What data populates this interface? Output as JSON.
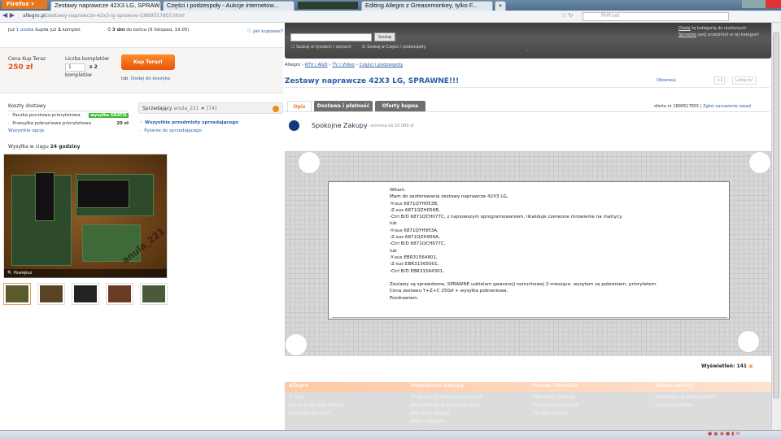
{
  "browser": {
    "menu_label": "Firefox",
    "tabs": [
      {
        "label": "Zestawy naprawcze 42X3 LG, SPRAW...",
        "active": true
      },
      {
        "label": "Części i podzespoły - Aukcje internetow...",
        "active": false
      },
      {
        "label": "Editing Allegro z Greasemonkey, tylko F...",
        "active": false
      }
    ],
    "new_tab": "+",
    "url_domain": "allegro.pl",
    "url_path": "/zestawy-naprawcze-42x3-lg-sprawne-i1899517855.html",
    "search_engine_placeholder": "PHP.net"
  },
  "top_info": {
    "bought_prefix": "Już",
    "bought_count": "1 osoba",
    "bought_suffix": "kupiła już",
    "bought_qty": "1",
    "bought_unit": "komplet",
    "days_left": "3 dni",
    "ends_text": "do końca (9 listopad, 19:05)",
    "how_to_buy": "Jak kupować?"
  },
  "purchase": {
    "price_label": "Cena Kup Teraz",
    "price": "250 zł",
    "qty_label": "Liczba kompletów",
    "qty_value": "1",
    "qty_of": "z 2",
    "qty_unit": "kompletów",
    "buy_button": "Kup Teraz!",
    "or": "lub",
    "add_to_cart": "Dodaj do koszyka"
  },
  "shipping": {
    "title": "Koszty dostawy",
    "items": [
      {
        "name": "Paczka pocztowa priorytetowa",
        "price": "wysyłka GRATIS"
      },
      {
        "name": "Przesyłka pobraniowa priorytetowa",
        "price": "20 zł"
      }
    ],
    "all_options": "Wszystkie opcje",
    "dispatch_prefix": "Wysyłka w ciągu",
    "dispatch_time": "24 godziny"
  },
  "seller": {
    "label": "Sprzedający",
    "name": "anula_221",
    "rating": "[74]",
    "links": [
      "Wszystkie przedmioty sprzedającego",
      "Pytanie do sprzedającego"
    ]
  },
  "gallery": {
    "enlarge": "Powiększ",
    "watermark": "anula_221",
    "thumbnail_count": 5
  },
  "search": {
    "value": "",
    "button": "Szukaj",
    "opt_titles": "Szukaj w tytułach i opisach",
    "opt_titles_checked": false,
    "opt_category_prefix": "Szukaj w",
    "opt_category": "Części i podzespoły",
    "opt_category_checked": true,
    "add_fav_link": "Dodaj",
    "add_fav_text": "tę kategorię do ulubionych",
    "sell_link": "Sprzedaj",
    "sell_text": "swój przedmiot w tej kategorii"
  },
  "breadcrumb": [
    "Allegro",
    "RTV i AGD",
    "TV i Video",
    "Części i podzespoły"
  ],
  "item": {
    "title": "Zestawy naprawcze 42X3 LG, SPRAWNE!!!",
    "watch": "Obserwuj",
    "gplus": "+1",
    "like": "Lubię to!",
    "offer_no": "oferta nr 1899517855",
    "report": "Zgłoś naruszenie zasad"
  },
  "tabs": [
    {
      "label": "Opis",
      "active": true
    },
    {
      "label": "Dostawa i płatność",
      "active": false
    },
    {
      "label": "Oferty kupna",
      "active": false
    }
  ],
  "protection": {
    "title": "Spokojne Zakupy",
    "text": "ochrona do 10 000 zł"
  },
  "description": [
    "Witam.",
    "Mam do zaoferowania zestawy naprawcze 42X3 LG,",
    "-Y-sus 6871QYH053B,",
    "-Z-sus 6871QZH056B,",
    "-Ctrl B/D 6871QCH077C, z najnowszym oprogramowaniem, likwiduje czerwone mrowienie na matrycy.",
    "lub",
    "-Y-sus 6871QYH953A,",
    "-Z-sus 6871QZH956A,",
    "-Ctrl B/D 6871QCH977C,",
    "lub",
    "-Y-sus EBR31564801,",
    "-Z-sus EBR31565001,",
    "-Ctrl B/D EBR31564301,",
    "",
    "Zestawy są sprawdzone, SPRAWNE udzielam gwarancji rozruchowej 2-miesiące. wysyłam za pobraniem, priorytetem.",
    "Cena zestawu Y+Z+C 250zł + wysyłka pobraniowa.",
    "Pozdrawiam."
  ],
  "views": {
    "label": "Wyświetleń:",
    "count": "141"
  },
  "footer": [
    {
      "heading": "Allegro",
      "links": [
        "O nas",
        "Praca w Grupie Allegro",
        "Reklama dla Firm"
      ]
    },
    {
      "heading": "Bezpieczne Zakupy",
      "links": [
        "Program Ochrony Kupujących",
        "Weryfikacja w Serwisie Pasa",
        "Mandaty Allegro",
        "Blog z Allegro"
      ]
    },
    {
      "heading": "Pomoc i kontakt",
      "links": [
        "Standard Obsługi",
        "Katalog produktów",
        "Sklepy Allegro"
      ]
    },
    {
      "heading": "Nasze serwisy",
      "links": [
        "Aplikacja na Twój telefon",
        "Strona mobilna"
      ]
    }
  ],
  "colors": {
    "accent": "#f06a14",
    "link": "#2a5ea8",
    "price": "#e8501a",
    "free_shipping": "#3cbb2f"
  }
}
